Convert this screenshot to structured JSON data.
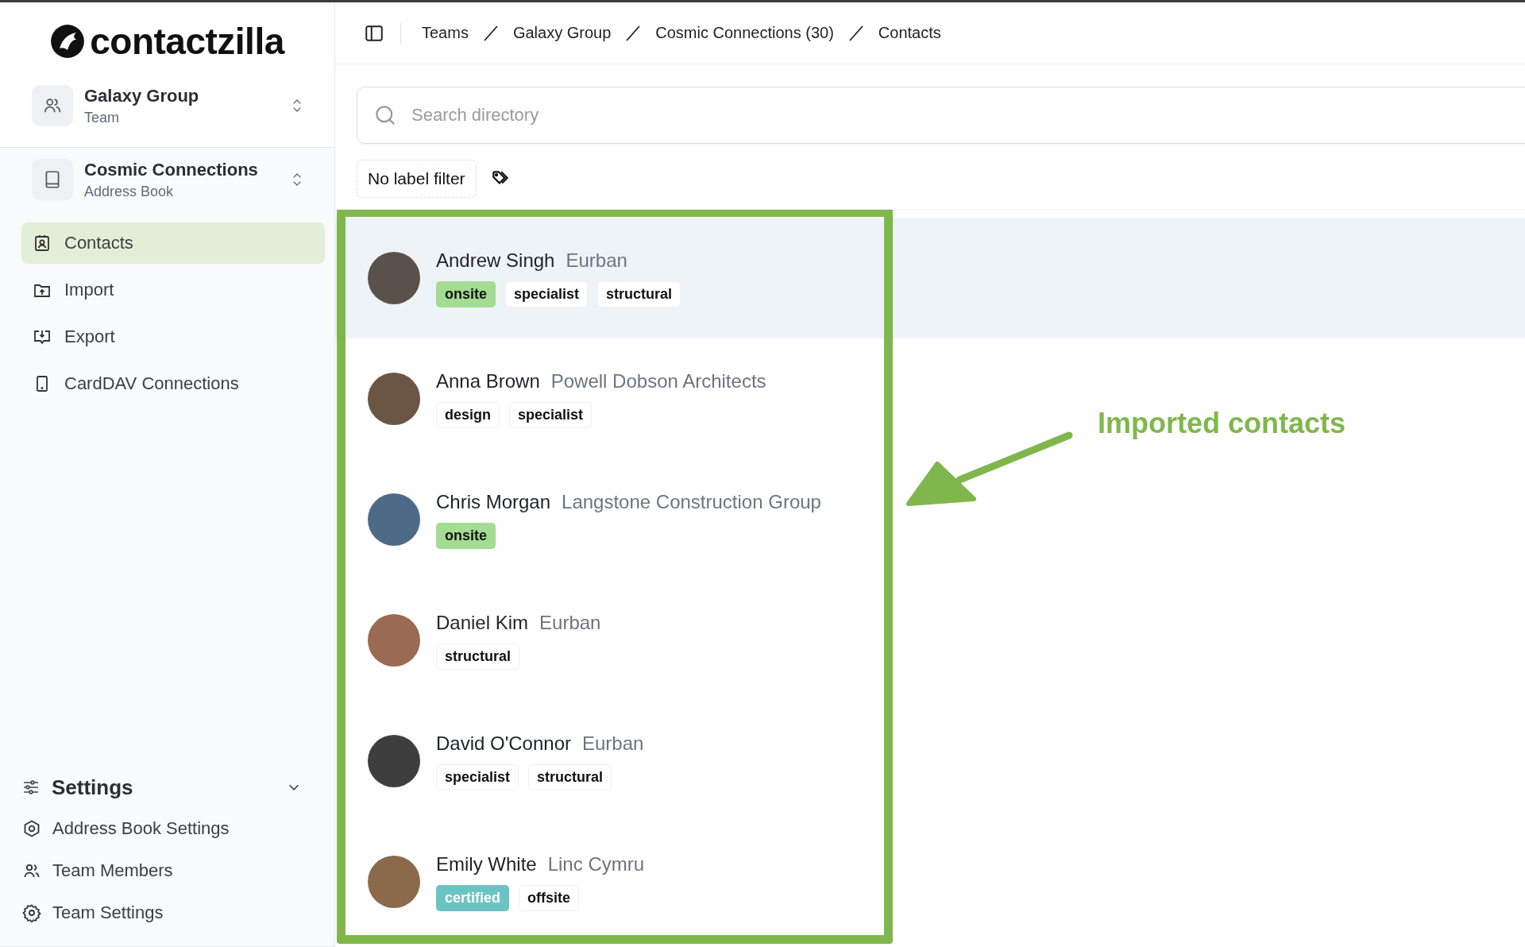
{
  "logo": {
    "text": "contactzilla"
  },
  "team_switcher": {
    "title": "Galaxy Group",
    "subtitle": "Team"
  },
  "book_switcher": {
    "title": "Cosmic Connections",
    "subtitle": "Address Book"
  },
  "nav": [
    {
      "label": "Contacts",
      "kind": "contacts",
      "selected": true
    },
    {
      "label": "Import",
      "kind": "import",
      "selected": false
    },
    {
      "label": "Export",
      "kind": "export",
      "selected": false
    },
    {
      "label": "CardDAV Connections",
      "kind": "carddav",
      "selected": false
    }
  ],
  "settings": {
    "title": "Settings",
    "expanded": true,
    "items": [
      {
        "label": "Address Book Settings",
        "kind": "book"
      },
      {
        "label": "Team Members",
        "kind": "members"
      },
      {
        "label": "Team Settings",
        "kind": "team"
      }
    ]
  },
  "breadcrumbs": [
    "Teams",
    "Galaxy Group",
    "Cosmic Connections (30)",
    "Contacts"
  ],
  "search": {
    "placeholder": "Search directory"
  },
  "label_filter": {
    "label": "No label filter"
  },
  "contacts": [
    {
      "name": "Andrew Singh",
      "company": "Eurban",
      "selected": true,
      "tags": [
        {
          "label": "onsite",
          "color": "#a3dc92"
        },
        {
          "label": "specialist"
        },
        {
          "label": "structural"
        }
      ]
    },
    {
      "name": "Anna Brown",
      "company": "Powell Dobson Architects",
      "selected": false,
      "tags": [
        {
          "label": "design"
        },
        {
          "label": "specialist"
        }
      ]
    },
    {
      "name": "Chris Morgan",
      "company": "Langstone Construction Group",
      "selected": false,
      "tags": [
        {
          "label": "onsite",
          "color": "#a3dc92"
        }
      ]
    },
    {
      "name": "Daniel Kim",
      "company": "Eurban",
      "selected": false,
      "tags": [
        {
          "label": "structural"
        }
      ]
    },
    {
      "name": "David O'Connor",
      "company": "Eurban",
      "selected": false,
      "tags": [
        {
          "label": "specialist"
        },
        {
          "label": "structural"
        }
      ]
    },
    {
      "name": "Emily White",
      "company": "Linc Cymru",
      "selected": false,
      "tags": [
        {
          "label": "certified",
          "color": "#6cc3c3"
        },
        {
          "label": "offsite"
        }
      ]
    }
  ],
  "annotation": {
    "text": "Imported contacts"
  }
}
